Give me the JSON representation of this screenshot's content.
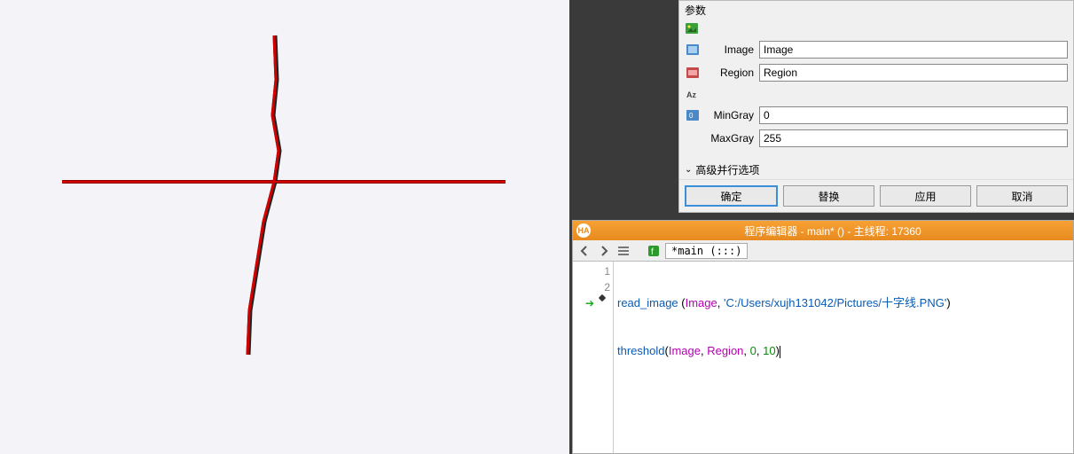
{
  "panel": {
    "title": "参数",
    "rows": {
      "image_label": "Image",
      "image_value": "Image",
      "region_label": "Region",
      "region_value": "Region",
      "mingray_label": "MinGray",
      "mingray_value": "0",
      "maxgray_label": "MaxGray",
      "maxgray_value": "255"
    },
    "advanced": "高级并行选项",
    "buttons": {
      "ok": "确定",
      "replace": "替换",
      "apply": "应用",
      "cancel": "取消"
    }
  },
  "editor": {
    "title": "程序编辑器 - main* () - 主线程: 17360",
    "breadcrumb": "*main (:::)",
    "lines": {
      "l1_fn": "read_image",
      "l1_var": "Image",
      "l1_str": "'C:/Users/xujh131042/Pictures/十字线.PNG'",
      "l2_fn": "threshold",
      "l2_var1": "Image",
      "l2_var2": "Region",
      "l2_n1": "0",
      "l2_n2": "10"
    }
  },
  "icons": {
    "img_icon": "image-icon",
    "region_icon": "region-icon",
    "int_icon": "int-icon"
  }
}
